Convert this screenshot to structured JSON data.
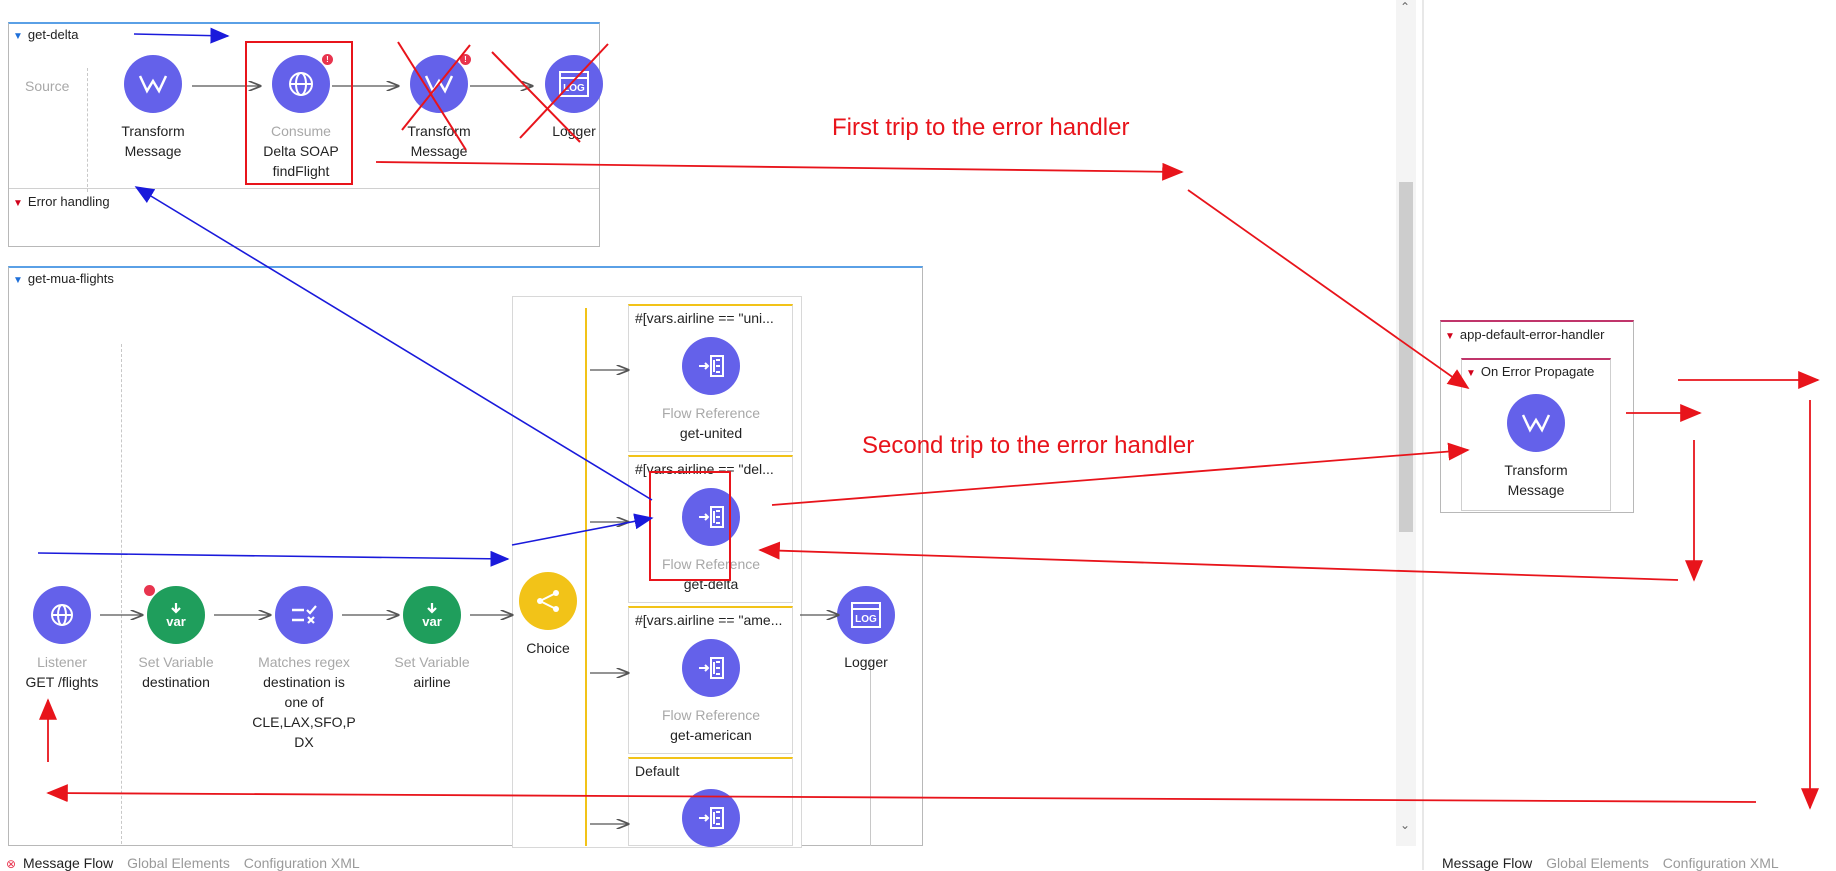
{
  "flows": {
    "get_delta": {
      "title": "get-delta",
      "source_label": "Source",
      "error_handling_label": "Error handling",
      "nodes": [
        {
          "category": "",
          "label": "Transform\nMessage",
          "icon": "transform-message-icon"
        },
        {
          "category": "Consume",
          "label": "Delta SOAP\nfindFlight",
          "icon": "web-service-consumer-icon"
        },
        {
          "category": "",
          "label": "Transform\nMessage",
          "icon": "transform-message-icon"
        },
        {
          "category": "",
          "label": "Logger",
          "icon": "logger-icon"
        }
      ]
    },
    "get_mua_flights": {
      "title": "get-mua-flights",
      "nodes": [
        {
          "category": "Listener",
          "label": "GET /flights",
          "icon": "http-listener-icon"
        },
        {
          "category": "Set Variable",
          "label": "destination",
          "icon": "set-variable-icon"
        },
        {
          "category": "Matches regex",
          "label": "destination is\none of\nCLE,LAX,SFO,P\nDX",
          "icon": "validation-icon"
        },
        {
          "category": "Set Variable",
          "label": "airline",
          "icon": "set-variable-icon"
        },
        {
          "category": "",
          "label": "Choice",
          "icon": "choice-router-icon"
        },
        {
          "category": "",
          "label": "Logger",
          "icon": "logger-icon"
        }
      ],
      "routes": [
        {
          "condition": "#[vars.airline == \"uni...",
          "category": "Flow Reference",
          "label": "get-united"
        },
        {
          "condition": "#[vars.airline == \"del...",
          "category": "Flow Reference",
          "label": "get-delta"
        },
        {
          "condition": "#[vars.airline == \"ame...",
          "category": "Flow Reference",
          "label": "get-american"
        },
        {
          "condition": "Default",
          "category": "",
          "label": ""
        }
      ]
    },
    "error_handler": {
      "title": "app-default-error-handler",
      "scope_title": "On Error Propagate",
      "node": {
        "category": "",
        "label": "Transform\nMessage",
        "icon": "transform-message-icon"
      }
    }
  },
  "annotations": {
    "first_trip": "First trip to the error handler",
    "second_trip": "Second trip to the error handler"
  },
  "tabs_left": [
    "Message Flow",
    "Global Elements",
    "Configuration XML"
  ],
  "tabs_right": [
    "Message Flow",
    "Global Elements",
    "Configuration XML"
  ],
  "colors": {
    "node_purple": "#6461ea",
    "node_green": "#1f9e5c",
    "node_yellow": "#f2c318",
    "annotation_red": "#e8141b",
    "annotation_blue": "#1a1adb",
    "error_badge": "#e8344e"
  }
}
